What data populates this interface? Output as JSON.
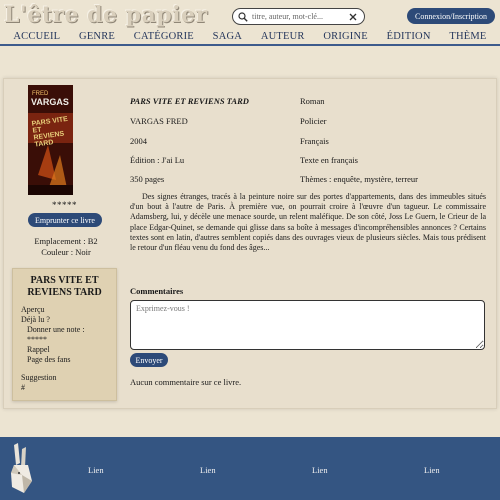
{
  "header": {
    "logo_text": "L'être de papier",
    "search_placeholder": "titre, auteur, mot-clé...",
    "login_label": "Connexion/Inscription"
  },
  "nav": [
    "ACCUEIL",
    "GENRE",
    "CATÉGORIE",
    "SAGA",
    "AUTEUR",
    "ORIGINE",
    "ÉDITION",
    "THÈME"
  ],
  "book": {
    "cover": {
      "author": "FRED",
      "brand": "VARGAS",
      "title_lines": [
        "PARS VITE",
        "ET REVIENS",
        "TARD"
      ]
    },
    "rating_stars": "*****",
    "borrow_label": "Emprunter ce livre",
    "location": "Emplacement : B2",
    "color": "Couleur : Noir",
    "title": "PARS VITE ET REVIENS TARD",
    "author": "VARGAS FRED",
    "year": "2004",
    "edition": "Édition : J'ai Lu",
    "pages": "350 pages",
    "type": "Roman",
    "genre": "Policier",
    "language": "Français",
    "text_language": "Texte en français",
    "themes": "Thèmes : enquête, mystère, terreur",
    "summary": "Des signes étranges, tracés à la peinture noire sur des portes d'appartements, dans des immeubles situés d'un bout à l'autre de Paris. À première vue, on pourrait croire à l'œuvre d'un tagueur. Le commissaire Adamsberg, lui, y décèle une menace sourde, un relent maléfique. De son côté, Joss Le Guern, le Crieur de la place Edgar-Quinet, se demande qui glisse dans sa boîte à messages d'incompréhensibles annonces ? Certains textes sont en latin, d'autres semblent copiés dans des ouvrages vieux de plusieurs siècles. Mais tous prédisent le retour d'un fléau venu du fond des âges..."
  },
  "sidebar": {
    "title": "PARS VITE ET REVIENS TARD",
    "apercu": "Aperçu",
    "deja_lu": "Déjà lu ?",
    "donner_note": "Donner une note :",
    "note_stars": "*****",
    "rappel": "Rappel",
    "page_fans": "Page des fans",
    "suggestion": "Suggestion",
    "hash": "#"
  },
  "comments": {
    "label": "Commentaires",
    "placeholder": "Exprimez-vous !",
    "send_label": "Envoyer",
    "empty_text": "Aucun commentaire sur ce livre."
  },
  "footer": {
    "links": [
      "Lien",
      "Lien",
      "Lien",
      "Lien"
    ]
  },
  "colors": {
    "background": "#ece4d2",
    "primary_button": "#2d4a78",
    "footer": "#345582",
    "nav_text": "#26375c"
  }
}
